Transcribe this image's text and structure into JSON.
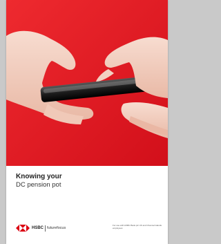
{
  "document": {
    "title_line1": "Knowing your",
    "title_line2": "DC pension pot"
  },
  "footer": {
    "brand": "HSBC",
    "sub_brand": "futurefocus",
    "fineprint": "For use with HSBC Bank plc UK and Channel Islands employees"
  },
  "colors": {
    "brand_red": "#db0011",
    "background_red": "#e1141f",
    "page_gray": "#c9c9c9"
  },
  "icons": {
    "logo": "hsbc-hexagon-logo",
    "photo": "hands-holding-smartphone"
  }
}
